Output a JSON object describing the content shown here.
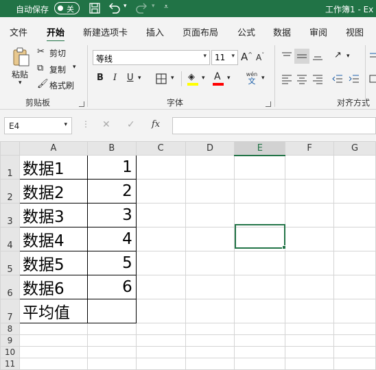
{
  "titlebar": {
    "autosave_label": "自动保存",
    "autosave_state": "关",
    "qat_more": "⩡",
    "doc_title": "工作簿1 - Ex"
  },
  "tabs": [
    "文件",
    "开始",
    "新建选项卡",
    "插入",
    "页面布局",
    "公式",
    "数据",
    "审阅",
    "视图"
  ],
  "active_tab": "开始",
  "clipboard": {
    "paste": "粘贴",
    "cut": "剪切",
    "copy": "复制",
    "format_painter": "格式刷",
    "group": "剪贴板"
  },
  "font": {
    "name": "等线",
    "size": "11",
    "bold": "B",
    "italic": "I",
    "underline": "U",
    "wen": "wén",
    "wen_char": "文",
    "group": "字体",
    "grow": "A",
    "shrink": "A"
  },
  "alignment": {
    "group": "对齐方式"
  },
  "formula_bar": {
    "name_box": "E4",
    "cancel": "✕",
    "enter": "✓",
    "fx": "fx",
    "value": ""
  },
  "sheet": {
    "columns": [
      "A",
      "B",
      "C",
      "D",
      "E",
      "F",
      "G"
    ],
    "selected_column": "E",
    "selected_row": "4",
    "rows": [
      {
        "num": "1",
        "a": "数据1",
        "b": "1"
      },
      {
        "num": "2",
        "a": "数据2",
        "b": "2"
      },
      {
        "num": "3",
        "a": "数据3",
        "b": "3"
      },
      {
        "num": "4",
        "a": "数据4",
        "b": "4"
      },
      {
        "num": "5",
        "a": "数据5",
        "b": "5"
      },
      {
        "num": "6",
        "a": "数据6",
        "b": "6"
      },
      {
        "num": "7",
        "a": "平均值",
        "b": ""
      },
      {
        "num": "8",
        "a": "",
        "b": ""
      },
      {
        "num": "9",
        "a": "",
        "b": ""
      },
      {
        "num": "10",
        "a": "",
        "b": ""
      },
      {
        "num": "11",
        "a": "",
        "b": ""
      }
    ]
  },
  "colors": {
    "accent": "#217346",
    "font_color": "#ff0000",
    "highlight": "#ffff00"
  }
}
